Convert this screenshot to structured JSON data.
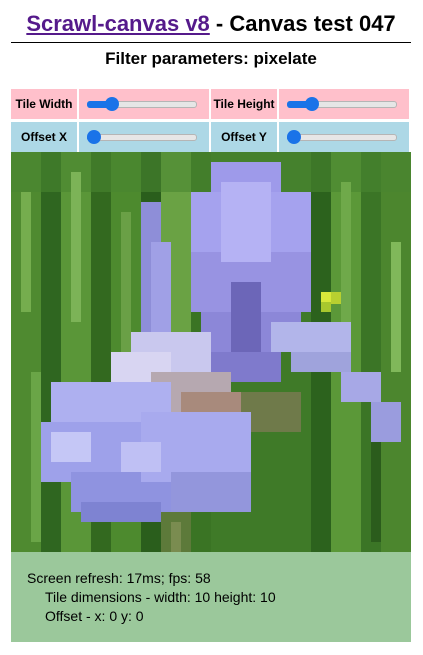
{
  "header": {
    "link_text": "Scrawl-canvas v8",
    "title_rest": " - Canvas test 047"
  },
  "subtitle": "Filter parameters: pixelate",
  "controls": {
    "tile_width": {
      "label": "Tile Width",
      "value": 10,
      "min": 1,
      "max": 50
    },
    "tile_height": {
      "label": "Tile Height",
      "value": 10,
      "min": 1,
      "max": 50
    },
    "offset_x": {
      "label": "Offset X",
      "value": 0,
      "min": 0,
      "max": 50
    },
    "offset_y": {
      "label": "Offset Y",
      "value": 0,
      "min": 0,
      "max": 50
    }
  },
  "colors": {
    "label_row1_bg": "#ffc0cb",
    "label_row2_bg": "#add8e6",
    "report_bg": "#9bc89b",
    "link": "#551a8b",
    "slider_accent": "#1a73e8"
  },
  "canvas": {
    "content": "pixelated photo of purple iris flower against green grass",
    "tile_size": 10
  },
  "report": {
    "line1": "Screen refresh: 17ms; fps: 58",
    "line2": "Tile dimensions - width: 10 height: 10",
    "line3": "Offset - x: 0 y: 0"
  }
}
